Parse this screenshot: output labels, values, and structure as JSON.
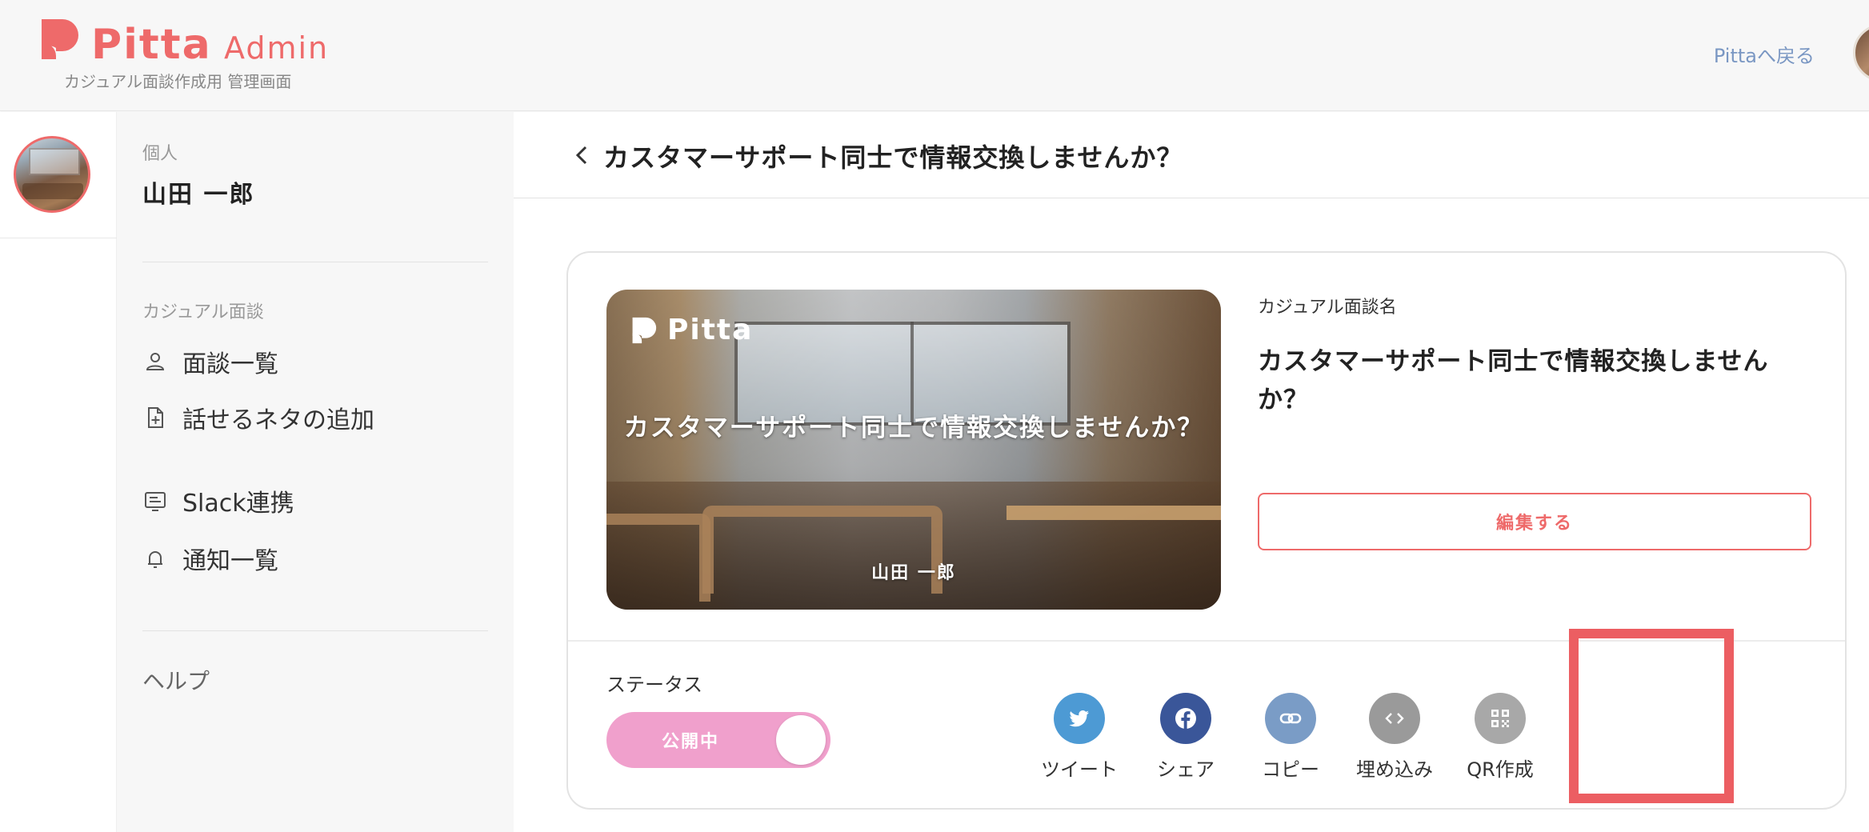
{
  "header": {
    "logo_text": "Pitta",
    "logo_admin": "Admin",
    "logo_subtitle": "カジュアル面談作成用 管理画面",
    "back_link": "Pittaへ戻る"
  },
  "sidebar": {
    "account_type": "個人",
    "user_name": "山田 一郎",
    "section_label": "カジュアル面談",
    "items": [
      {
        "label": "面談一覧",
        "icon": "person-icon"
      },
      {
        "label": "話せるネタの追加",
        "icon": "add-document-icon"
      },
      {
        "label": "Slack連携",
        "icon": "slack-connect-icon"
      },
      {
        "label": "通知一覧",
        "icon": "bell-icon"
      }
    ],
    "help": "ヘルプ"
  },
  "main": {
    "page_title": "カスタマーサポート同士で情報交換しませんか？",
    "cover": {
      "logo_text": "Pitta",
      "title": "カスタマーサポート同士で情報交換しませんか？",
      "author": "山田 一郎"
    },
    "info": {
      "label": "カジュアル面談名",
      "title": "カスタマーサポート同士で情報交換しませんか？",
      "edit_button": "編集する"
    },
    "status": {
      "label": "ステータス",
      "toggle_text": "公開中",
      "published": true
    },
    "share": [
      {
        "label": "ツイート",
        "icon": "twitter-icon",
        "color": "#4d9ad4"
      },
      {
        "label": "シェア",
        "icon": "facebook-icon",
        "color": "#3a5699"
      },
      {
        "label": "コピー",
        "icon": "link-icon",
        "color": "#7a9cc6"
      },
      {
        "label": "埋め込み",
        "icon": "code-icon",
        "color": "#9a9a9a"
      },
      {
        "label": "QR作成",
        "icon": "qr-code-icon",
        "color": "#a8a8a8"
      }
    ]
  },
  "colors": {
    "brand": "#ee6a6a",
    "toggle_on": "#f0a0cc",
    "highlight": "#ec5e62"
  }
}
